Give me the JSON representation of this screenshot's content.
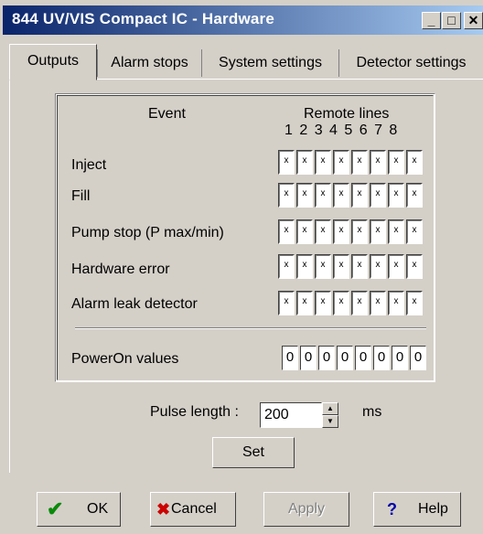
{
  "window": {
    "title": "844 UV/VIS Compact IC - Hardware"
  },
  "tabs": [
    {
      "label": "Outputs",
      "active": true
    },
    {
      "label": "Alarm stops",
      "active": false
    },
    {
      "label": "System settings",
      "active": false
    },
    {
      "label": "Detector settings",
      "active": false
    }
  ],
  "outputs": {
    "event_header": "Event",
    "remote_header": "Remote lines",
    "line_numbers": "1 2 3 4 5 6 7 8",
    "events": [
      {
        "label": "Inject",
        "lines": [
          "x",
          "x",
          "x",
          "x",
          "x",
          "x",
          "x",
          "x"
        ]
      },
      {
        "label": "Fill",
        "lines": [
          "x",
          "x",
          "x",
          "x",
          "x",
          "x",
          "x",
          "x"
        ]
      },
      {
        "label": "Pump stop (P max/min)",
        "lines": [
          "x",
          "x",
          "x",
          "x",
          "x",
          "x",
          "x",
          "x"
        ]
      },
      {
        "label": "Hardware error",
        "lines": [
          "x",
          "x",
          "x",
          "x",
          "x",
          "x",
          "x",
          "x"
        ]
      },
      {
        "label": "Alarm leak detector",
        "lines": [
          "x",
          "x",
          "x",
          "x",
          "x",
          "x",
          "x",
          "x"
        ]
      }
    ],
    "poweron_label": "PowerOn values",
    "poweron_values": [
      "0",
      "0",
      "0",
      "0",
      "0",
      "0",
      "0",
      "0"
    ]
  },
  "pulse": {
    "label": "Pulse length :",
    "value": "200",
    "unit": "ms"
  },
  "set_button": "Set",
  "buttons": {
    "ok": "OK",
    "cancel": "Cancel",
    "apply": "Apply",
    "help": "Help"
  },
  "colors": {
    "titlebar_start": "#0a246a",
    "titlebar_end": "#a6caf0",
    "face": "#d4d0c8",
    "ok_check": "#0a8a0a",
    "cancel_x": "#cc0000",
    "help_q": "#0000aa"
  }
}
